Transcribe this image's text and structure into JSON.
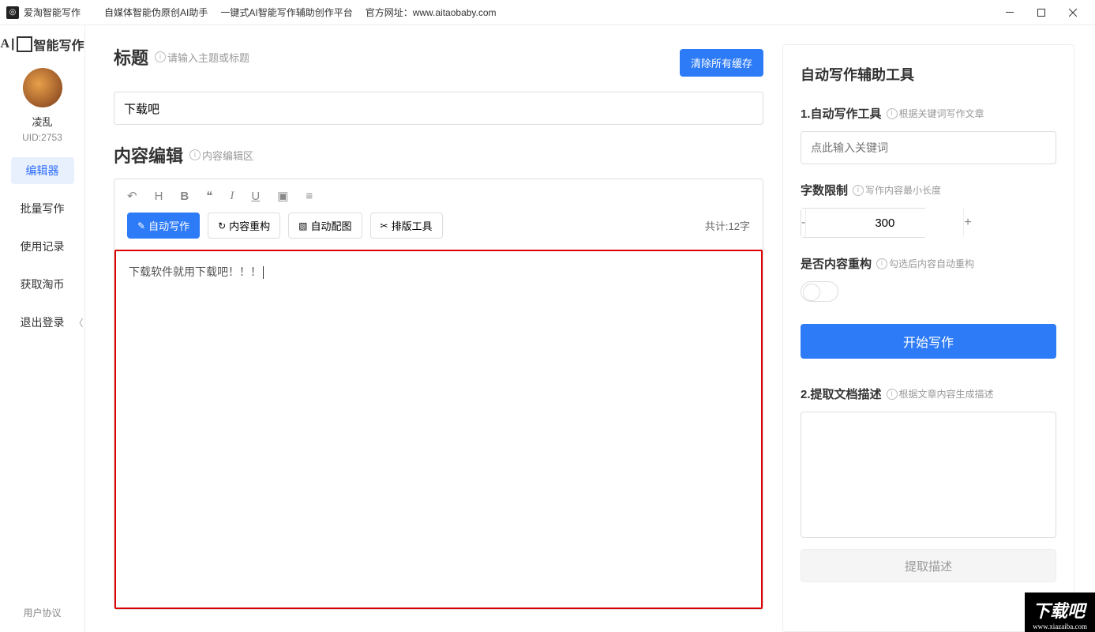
{
  "titlebar": {
    "app_name": "爱淘智能写作",
    "tagline1": "自媒体智能伪原创AI助手",
    "tagline2": "一键式AI智能写作辅助创作平台",
    "site_label": "官方网址：www.aitaobaby.com"
  },
  "sidebar": {
    "logo_text": "智能写作",
    "username": "凌乱",
    "uid": "UID:2753",
    "nav": {
      "editor": "编辑器",
      "batch": "批量写作",
      "history": "使用记录",
      "coins": "获取淘币",
      "logout": "退出登录"
    },
    "footer": "用户协议"
  },
  "editor": {
    "title_label": "标题",
    "title_hint": "请输入主题或标题",
    "clear_cache": "清除所有缓存",
    "title_value": "下载吧",
    "content_label": "内容编辑",
    "content_hint": "内容编辑区",
    "buttons": {
      "auto_write": "自动写作",
      "restructure": "内容重构",
      "auto_image": "自动配图",
      "layout_tool": "排版工具"
    },
    "word_count": "共计:12字",
    "text_content": "下载软件就用下载吧！！！"
  },
  "right": {
    "panel_title": "自动写作辅助工具",
    "section1_title": "1.自动写作工具",
    "section1_hint": "根据关键词写作文章",
    "kw_placeholder": "点此输入关键词",
    "wordlimit_title": "字数限制",
    "wordlimit_hint": "写作内容最小长度",
    "wordlimit_value": "300",
    "restructure_title": "是否内容重构",
    "restructure_hint": "勾选后内容自动重构",
    "start_btn": "开始写作",
    "section2_title": "2.提取文档描述",
    "section2_hint": "根据文章内容生成描述",
    "extract_btn": "提取描述"
  },
  "watermark": {
    "text": "下载吧",
    "url": "www.xiazaiba.com"
  }
}
